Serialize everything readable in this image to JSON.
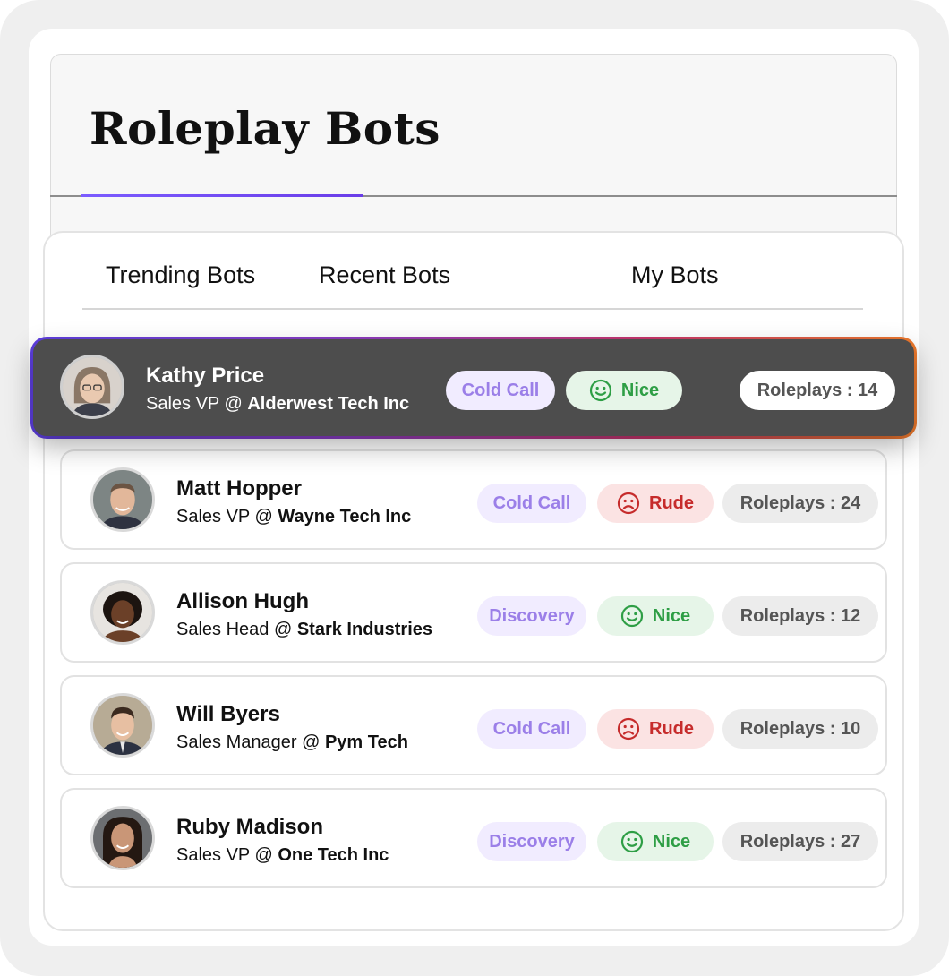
{
  "page": {
    "title": "Roleplay Bots"
  },
  "tabs": [
    {
      "label": "Trending Bots"
    },
    {
      "label": "Recent Bots"
    },
    {
      "label": "My Bots"
    }
  ],
  "colors": {
    "accent": "#6a3de8",
    "nice_bg": "#e6f5e8",
    "nice_fg": "#2e9e45",
    "rude_bg": "#fbe3e3",
    "rude_fg": "#c62c2c",
    "type_bg": "#f1ecff",
    "type_fg": "#9b7fe8",
    "featured_bg": "#4d4d4d"
  },
  "bots": [
    {
      "name": "Kathy Price",
      "title_prefix": "Sales VP @ ",
      "company": "Alderwest Tech Inc",
      "call_type": "Cold Call",
      "mood": "Nice",
      "mood_icon": "smile-icon",
      "roleplays": "Roleplays : 14",
      "featured": true
    },
    {
      "name": "Matt Hopper",
      "title_prefix": "Sales VP @ ",
      "company": "Wayne Tech Inc",
      "call_type": "Cold Call",
      "mood": "Rude",
      "mood_icon": "frown-icon",
      "roleplays": "Roleplays : 24"
    },
    {
      "name": "Allison Hugh",
      "title_prefix": "Sales Head @ ",
      "company": "Stark Industries",
      "call_type": "Discovery",
      "mood": "Nice",
      "mood_icon": "smile-icon",
      "roleplays": "Roleplays : 12"
    },
    {
      "name": "Will Byers",
      "title_prefix": "Sales Manager @ ",
      "company": "Pym Tech",
      "call_type": "Cold Call",
      "mood": "Rude",
      "mood_icon": "frown-icon",
      "roleplays": "Roleplays : 10"
    },
    {
      "name": "Ruby Madison",
      "title_prefix": "Sales VP @ ",
      "company": "One Tech Inc",
      "call_type": "Discovery",
      "mood": "Nice",
      "mood_icon": "smile-icon",
      "roleplays": "Roleplays : 27"
    }
  ]
}
